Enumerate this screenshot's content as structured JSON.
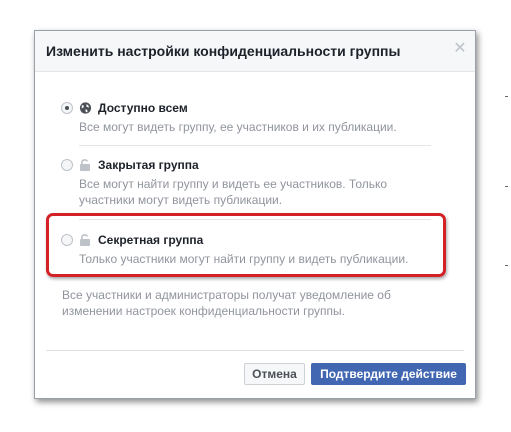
{
  "dialog": {
    "title": "Изменить настройки конфиденциальности группы",
    "close_icon": "close-icon",
    "options": [
      {
        "label": "Доступно всем",
        "description": "Все могут видеть группу, ее участников и их публикации.",
        "icon": "globe-icon",
        "selected": true
      },
      {
        "label": "Закрытая группа",
        "description": "Все могут найти группу и видеть ее участников. Только участники могут видеть публикации.",
        "icon": "lock-icon",
        "selected": false
      },
      {
        "label": "Секретная группа",
        "description": "Только участники могут найти группу и видеть публикации.",
        "icon": "lock-icon",
        "selected": false
      }
    ],
    "notice": "Все участники и администраторы получат уведомление об изменении настроек конфиденциальности группы.",
    "cancel_label": "Отмена",
    "confirm_label": "Подтвердите действие"
  },
  "colors": {
    "highlight": "#d32127",
    "primary_button": "#4267b2"
  }
}
